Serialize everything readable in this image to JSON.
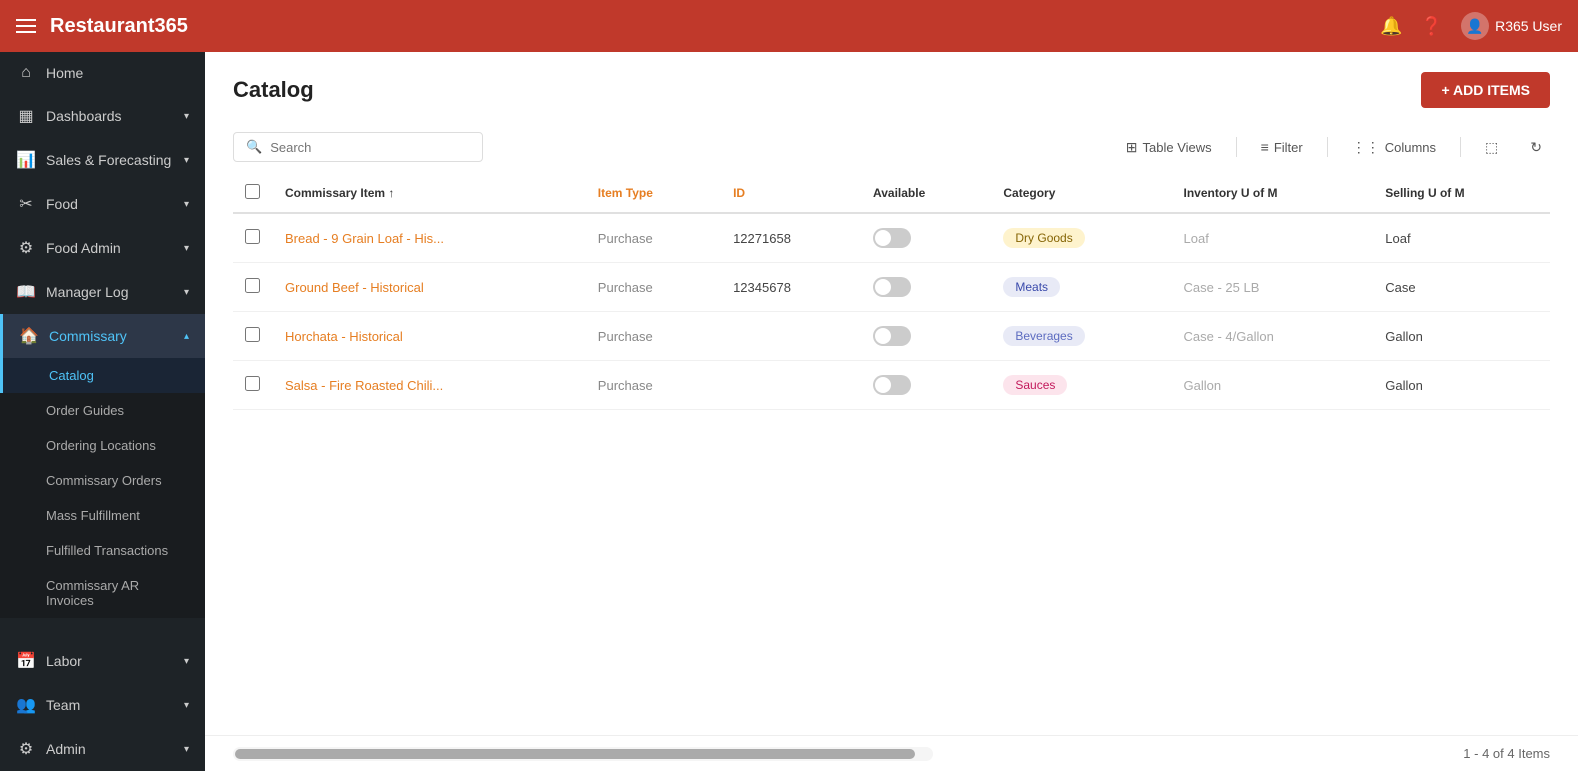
{
  "topbar": {
    "logo": "Restaurant365",
    "user": "R365 User"
  },
  "sidebar": {
    "items": [
      {
        "id": "home",
        "label": "Home",
        "icon": "⌂",
        "hasChevron": false
      },
      {
        "id": "dashboards",
        "label": "Dashboards",
        "icon": "▦",
        "hasChevron": true
      },
      {
        "id": "sales-forecasting",
        "label": "Sales & Forecasting",
        "icon": "📊",
        "hasChevron": true
      },
      {
        "id": "food",
        "label": "Food",
        "icon": "✂",
        "hasChevron": true
      },
      {
        "id": "food-admin",
        "label": "Food Admin",
        "icon": "⚙",
        "hasChevron": true
      },
      {
        "id": "manager-log",
        "label": "Manager Log",
        "icon": "📖",
        "hasChevron": true
      },
      {
        "id": "commissary",
        "label": "Commissary",
        "icon": "🏠",
        "hasChevron": true,
        "active": true
      }
    ],
    "commissary_sub": [
      {
        "id": "catalog",
        "label": "Catalog",
        "active": true
      },
      {
        "id": "order-guides",
        "label": "Order Guides"
      },
      {
        "id": "ordering-locations",
        "label": "Ordering Locations"
      },
      {
        "id": "commissary-orders",
        "label": "Commissary Orders"
      },
      {
        "id": "mass-fulfillment",
        "label": "Mass Fulfillment"
      },
      {
        "id": "fulfilled-transactions",
        "label": "Fulfilled Transactions"
      },
      {
        "id": "commissary-ar-invoices",
        "label": "Commissary AR Invoices"
      }
    ],
    "bottom_items": [
      {
        "id": "labor",
        "label": "Labor",
        "icon": "📅",
        "hasChevron": true
      },
      {
        "id": "team",
        "label": "Team",
        "icon": "👥",
        "hasChevron": true
      },
      {
        "id": "admin",
        "label": "Admin",
        "icon": "⚙",
        "hasChevron": true
      }
    ]
  },
  "page": {
    "title": "Catalog",
    "add_button": "+ ADD ITEMS"
  },
  "toolbar": {
    "search_placeholder": "Search",
    "table_views_label": "Table Views",
    "filter_label": "Filter",
    "columns_label": "Columns"
  },
  "table": {
    "columns": [
      {
        "id": "commissary-item",
        "label": "Commissary Item",
        "sortable": true
      },
      {
        "id": "item-type",
        "label": "Item Type",
        "orange": true
      },
      {
        "id": "id",
        "label": "ID",
        "orange": true
      },
      {
        "id": "available",
        "label": "Available"
      },
      {
        "id": "category",
        "label": "Category"
      },
      {
        "id": "inventory-uom",
        "label": "Inventory U of M"
      },
      {
        "id": "selling-uom",
        "label": "Selling U of M"
      }
    ],
    "rows": [
      {
        "id": "row-1",
        "commissary_item": "Bread - 9 Grain Loaf - His...",
        "item_type": "Purchase",
        "item_id": "12271658",
        "available": false,
        "category": "Dry Goods",
        "category_class": "badge-dry-goods",
        "inventory_uom": "Loaf",
        "selling_uom": "Loaf"
      },
      {
        "id": "row-2",
        "commissary_item": "Ground Beef - Historical",
        "item_type": "Purchase",
        "item_id": "12345678",
        "available": false,
        "category": "Meats",
        "category_class": "badge-meats",
        "inventory_uom": "Case - 25 LB",
        "selling_uom": "Case"
      },
      {
        "id": "row-3",
        "commissary_item": "Horchata - Historical",
        "item_type": "Purchase",
        "item_id": "",
        "available": false,
        "category": "Beverages",
        "category_class": "badge-beverages",
        "inventory_uom": "Case - 4/Gallon",
        "selling_uom": "Gallon"
      },
      {
        "id": "row-4",
        "commissary_item": "Salsa - Fire Roasted Chili...",
        "item_type": "Purchase",
        "item_id": "",
        "available": false,
        "category": "Sauces",
        "category_class": "badge-sauces",
        "inventory_uom": "Gallon",
        "selling_uom": "Gallon"
      }
    ]
  },
  "footer": {
    "count_label": "1 - 4 of 4 Items"
  }
}
